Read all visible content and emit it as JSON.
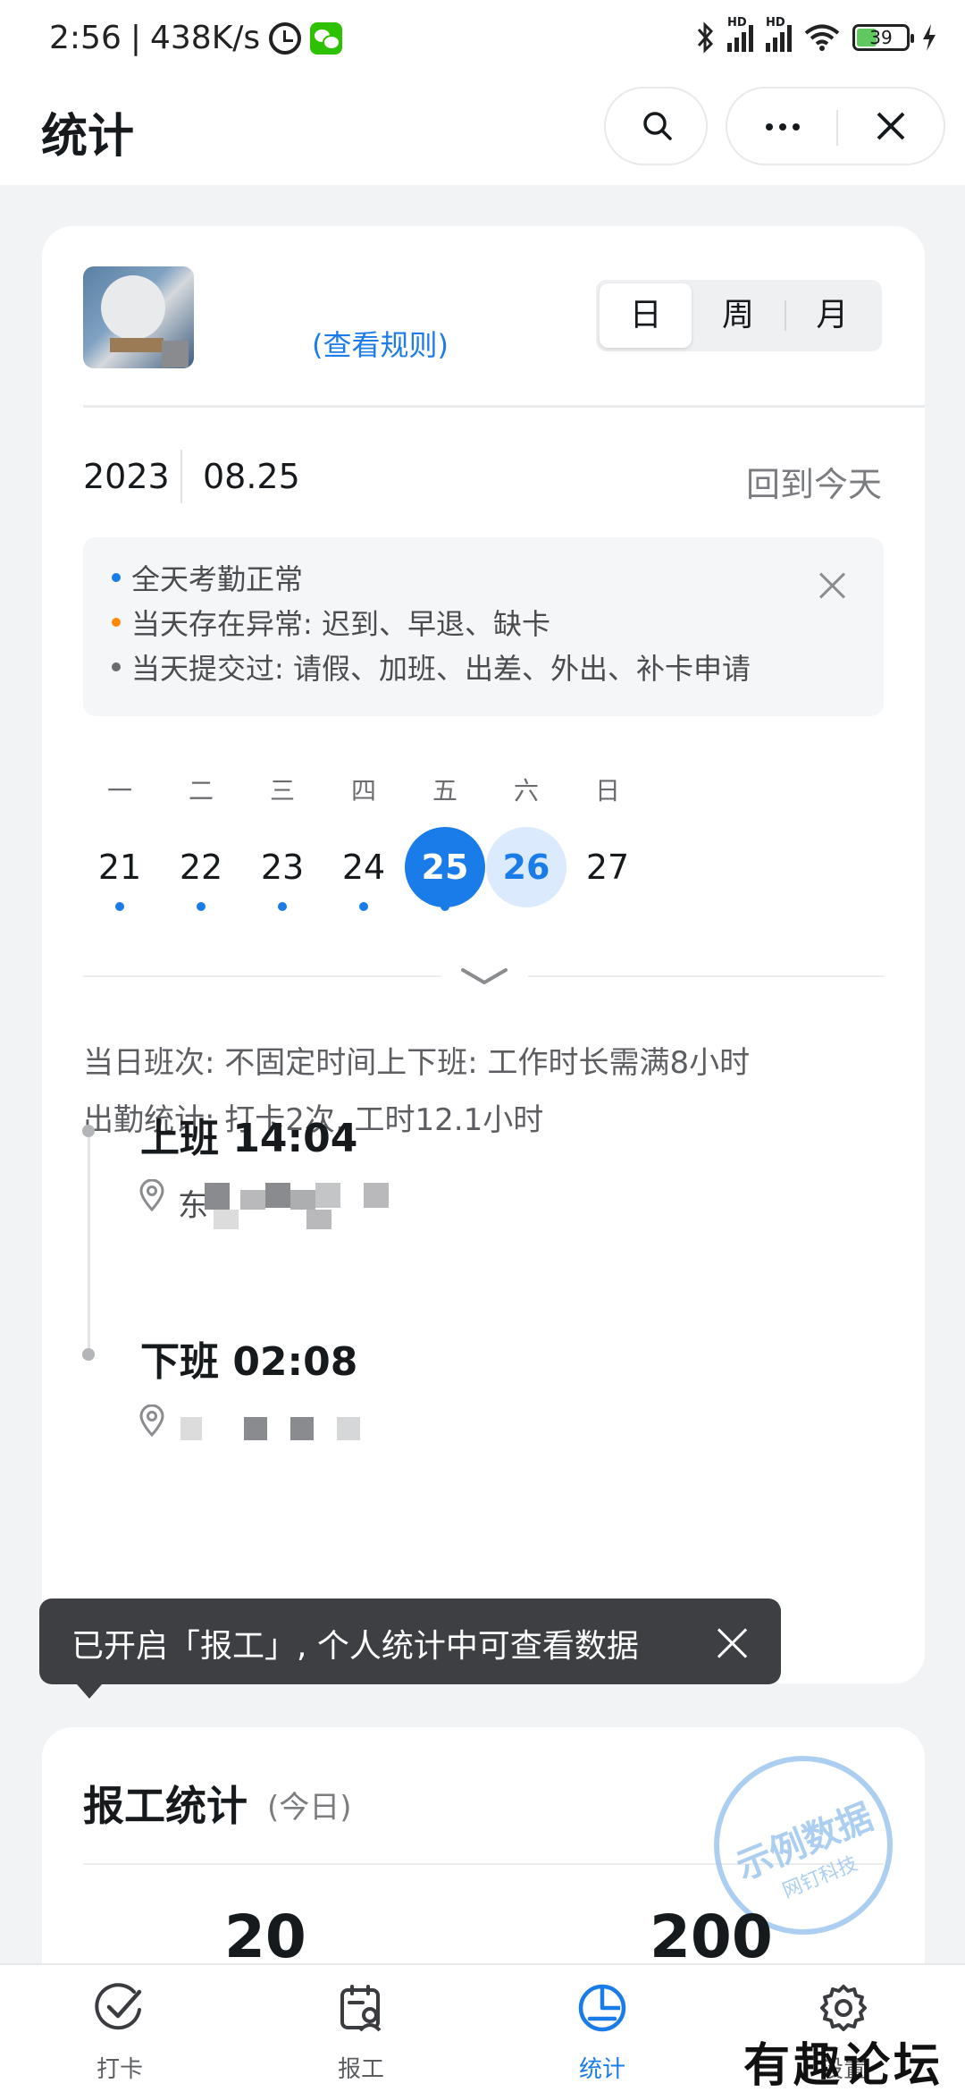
{
  "status_bar": {
    "time": "2:56",
    "network_speed": "438K/s",
    "battery_level": "39",
    "left_icons": [
      "alarm-icon",
      "wechat-icon"
    ],
    "right_icons": [
      "bluetooth-icon",
      "signal-hd-icon",
      "signal-hd-icon",
      "wifi-icon",
      "battery-icon",
      "charging-icon"
    ]
  },
  "header": {
    "title": "统计",
    "search_icon": "search-icon",
    "more_icon": "more-icon",
    "close_icon": "close-icon"
  },
  "profile": {
    "rules_link": "(查看规则)"
  },
  "view_toggle": {
    "options": [
      "日",
      "周",
      "月"
    ],
    "selected": "日"
  },
  "date": {
    "year": "2023",
    "month_day": "08.25",
    "back_to_today": "回到今天"
  },
  "legend": {
    "items": [
      {
        "text": "全天考勤正常",
        "color": "#1a7ce8"
      },
      {
        "text": "当天存在异常: 迟到、早退、缺卡",
        "color": "#ff8a00"
      },
      {
        "text": "当天提交过: 请假、加班、出差、外出、补卡申请",
        "color": "#6a6c70"
      }
    ]
  },
  "week": {
    "days": [
      {
        "label": "一",
        "num": "21",
        "dot": true,
        "state": "normal"
      },
      {
        "label": "二",
        "num": "22",
        "dot": true,
        "state": "normal"
      },
      {
        "label": "三",
        "num": "23",
        "dot": true,
        "state": "normal"
      },
      {
        "label": "四",
        "num": "24",
        "dot": true,
        "state": "normal"
      },
      {
        "label": "五",
        "num": "25",
        "dot": true,
        "state": "selected"
      },
      {
        "label": "六",
        "num": "26",
        "dot": false,
        "state": "today"
      },
      {
        "label": "日",
        "num": "27",
        "dot": false,
        "state": "normal"
      }
    ]
  },
  "shift_info": {
    "schedule": "当日班次: 不固定时间上下班: 工作时长需满8小时",
    "attendance": "出勤统计: 打卡2次, 工时12.1小时"
  },
  "punches": [
    {
      "label": "上班 14:04",
      "location_prefix": "东"
    },
    {
      "label": "下班 02:08",
      "location_prefix": ""
    }
  ],
  "toast": {
    "text": "已开启「报工」, 个人统计中可查看数据"
  },
  "report_stats": {
    "title": "报工统计",
    "subtitle": "(今日)",
    "stamp_text": "示例数据",
    "stamp_sub": "网钉科技",
    "values": [
      "20",
      "200"
    ]
  },
  "tabbar": {
    "tabs": [
      {
        "label": "打卡",
        "icon": "check-icon"
      },
      {
        "label": "报工",
        "icon": "report-icon"
      },
      {
        "label": "统计",
        "icon": "stats-icon",
        "active": true
      },
      {
        "label": "设置",
        "icon": "gear-icon"
      }
    ]
  },
  "watermark": "有趣论坛",
  "colors": {
    "accent": "#1a7ce8",
    "today_bg": "#dbeafc",
    "warning": "#ff8a00",
    "toast_bg": "#3d3f43"
  }
}
